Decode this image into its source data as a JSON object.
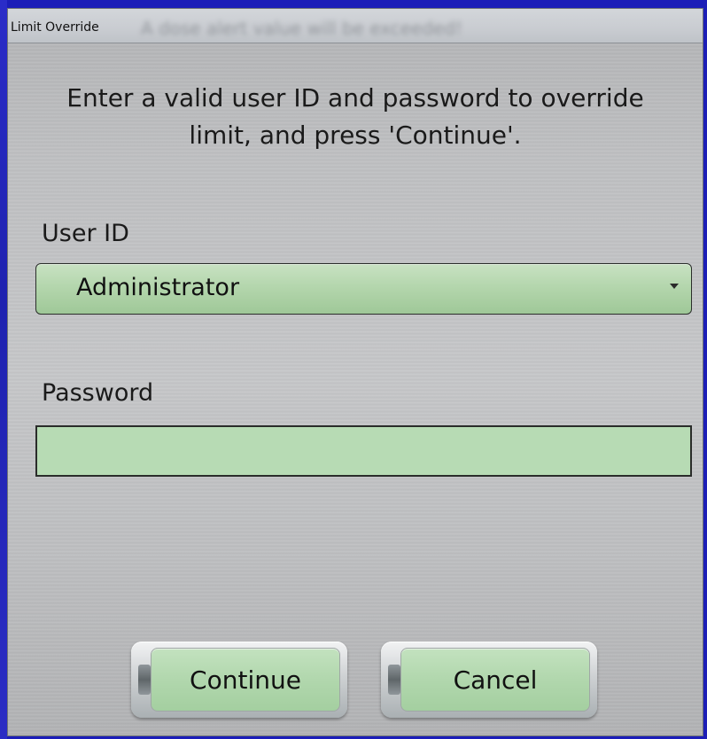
{
  "window": {
    "title": "Limit Override",
    "background_text": "A dose alert value will be exceeded!"
  },
  "instruction": {
    "line1": "Enter a valid user ID and password to override",
    "line2": "limit, and press 'Continue'."
  },
  "user_id": {
    "label": "User ID",
    "selected": "Administrator",
    "icon": "chevron-down-icon"
  },
  "password": {
    "label": "Password",
    "value": ""
  },
  "buttons": {
    "continue": "Continue",
    "cancel": "Cancel"
  },
  "colors": {
    "desktop": "#1b1db8",
    "field_green": "#b7dbb4",
    "button_green": "#b1d7ad"
  }
}
